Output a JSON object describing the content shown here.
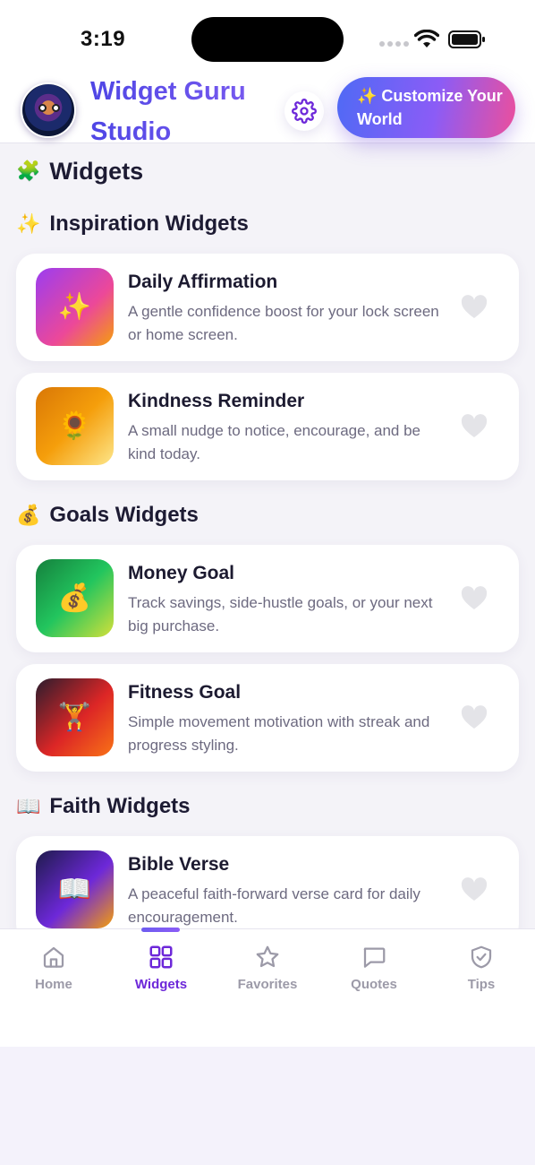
{
  "status_bar": {
    "time": "3:19"
  },
  "header": {
    "app_title": "Widget Guru Studio",
    "customize_label": "✨ Customize Your World"
  },
  "page_title": {
    "emoji": "🧩",
    "text": "Widgets"
  },
  "sections": [
    {
      "emoji": "✨",
      "title": "Inspiration Widgets",
      "items": [
        {
          "icon": "✨",
          "title": "Daily Affirmation",
          "description": "A gentle confidence boost for your lock screen or home screen.",
          "favorited": false
        },
        {
          "icon": "🌻",
          "title": "Kindness Reminder",
          "description": "A small nudge to notice, encourage, and be kind today.",
          "favorited": false
        }
      ]
    },
    {
      "emoji": "💰",
      "title": "Goals Widgets",
      "items": [
        {
          "icon": "💰",
          "title": "Money Goal",
          "description": "Track savings, side-hustle goals, or your next big purchase.",
          "favorited": false
        },
        {
          "icon": "🏋",
          "title": "Fitness Goal",
          "description": "Simple movement motivation with streak and progress styling.",
          "favorited": false
        }
      ]
    },
    {
      "emoji": "📖",
      "title": "Faith Widgets",
      "items": [
        {
          "icon": "📖",
          "title": "Bible Verse",
          "description": "A peaceful faith-forward verse card for daily encouragement.",
          "favorited": false
        }
      ]
    }
  ],
  "tabs": [
    {
      "label": "Home",
      "icon": "home-icon",
      "active": false
    },
    {
      "label": "Widgets",
      "icon": "grid-icon",
      "active": true
    },
    {
      "label": "Favorites",
      "icon": "star-icon",
      "active": false
    },
    {
      "label": "Quotes",
      "icon": "chat-icon",
      "active": false
    },
    {
      "label": "Tips",
      "icon": "shield-check-icon",
      "active": false
    }
  ],
  "colors": {
    "accent": "#6d28d9",
    "title_gradient_start": "#4f46e5",
    "button_gradient_end": "#ec4f9c"
  }
}
